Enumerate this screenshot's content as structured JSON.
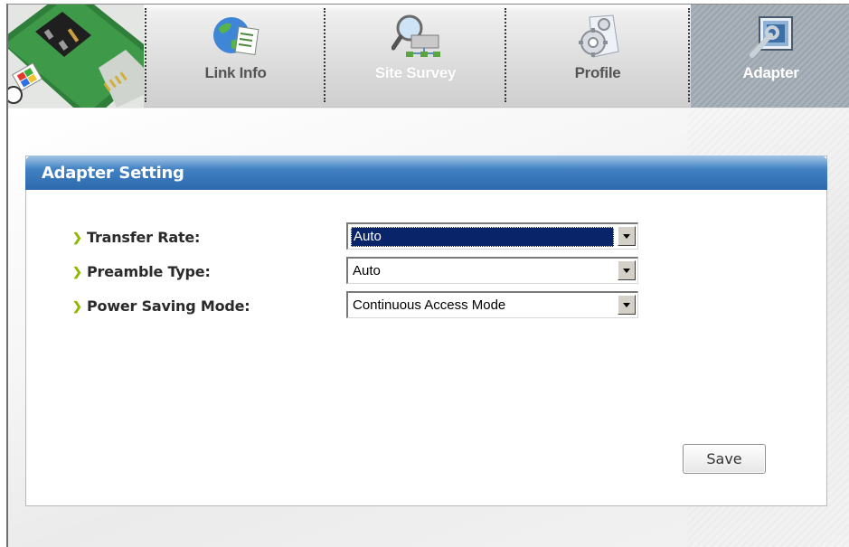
{
  "nav": {
    "tabs": [
      {
        "label": "Link Info",
        "icon": "globe-document-icon",
        "state": "normal"
      },
      {
        "label": "Site Survey",
        "icon": "magnifier-network-icon",
        "state": "faded"
      },
      {
        "label": "Profile",
        "icon": "gear-document-icon",
        "state": "normal"
      },
      {
        "label": "Adapter",
        "icon": "adapter-wrench-icon",
        "state": "active"
      }
    ]
  },
  "panel": {
    "title": "Adapter Setting",
    "fields": [
      {
        "label": "Transfer Rate:",
        "value": "Auto",
        "focused": true
      },
      {
        "label": "Preamble Type:",
        "value": "Auto",
        "focused": false
      },
      {
        "label": "Power Saving Mode:",
        "value": "Continuous Access Mode",
        "focused": false
      }
    ],
    "save_label": "Save"
  },
  "colors": {
    "header_blue": "#2c69ad",
    "active_tab": "#a3acb5",
    "bullet_green": "#8fb800",
    "focus_blue": "#0a246a"
  }
}
